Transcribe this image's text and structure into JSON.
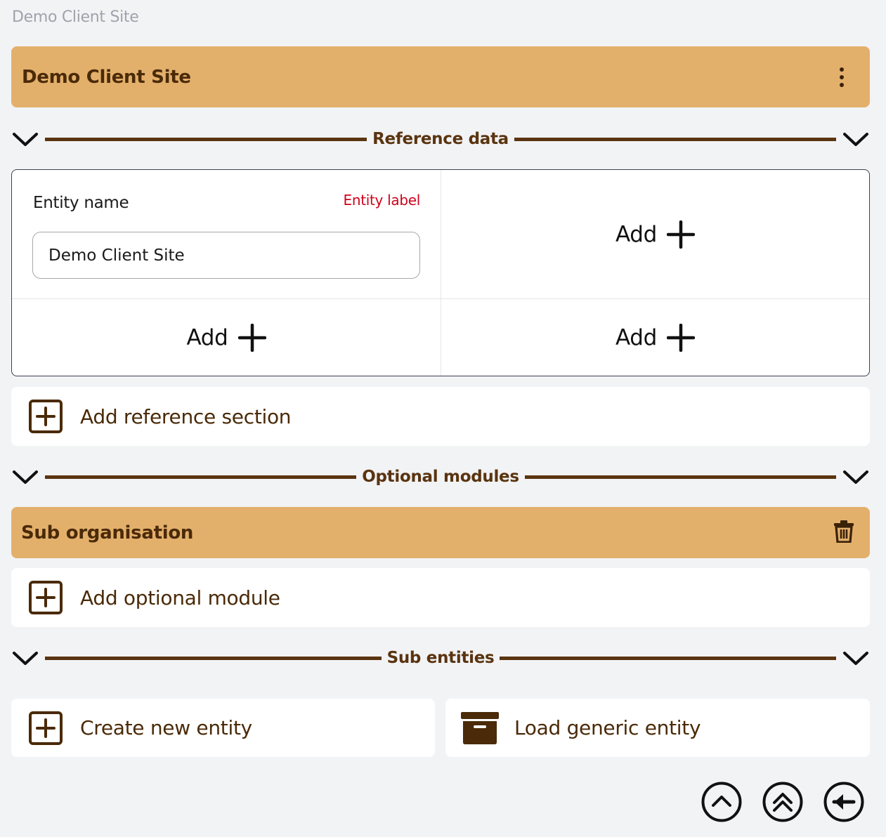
{
  "breadcrumb": "Demo Client Site",
  "header": {
    "title": "Demo Client Site"
  },
  "reference_section": {
    "title": "Reference data",
    "field": {
      "label": "Entity name",
      "tag": "Entity label",
      "value": "Demo Client Site"
    },
    "add_label": "Add",
    "add_section_label": "Add reference section"
  },
  "optional_section": {
    "title": "Optional modules",
    "module_title": "Sub organisation",
    "add_label": "Add optional module"
  },
  "sub_entities": {
    "title": "Sub entities",
    "create_label": "Create new entity",
    "load_label": "Load generic entity"
  },
  "colors": {
    "accent": "#e3b06c",
    "brand_brown": "#5a3410",
    "background": "#f2f3f5",
    "error_red": "#d0021b"
  },
  "icons": [
    "kebab-menu-icon",
    "chevron-down-icon",
    "plus-icon",
    "plus-square-icon",
    "trash-icon",
    "archive-icon",
    "scroll-up-icon",
    "scroll-top-icon",
    "back-arrow-icon"
  ]
}
